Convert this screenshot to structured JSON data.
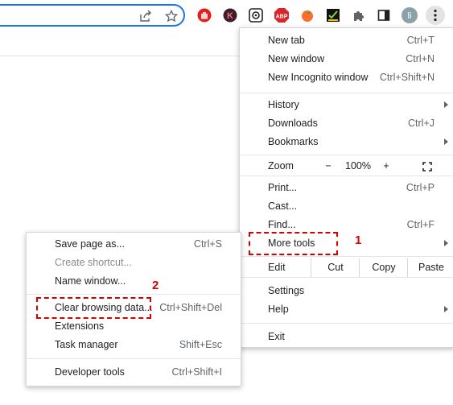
{
  "toolbar": {
    "icons": [
      "share-icon",
      "bookmark-star-icon",
      "red-hand-extension-icon",
      "k-extension-icon",
      "spiral-extension-icon",
      "adblock-plus-icon",
      "tomato-extension-icon",
      "checkmark-extension-icon",
      "puzzle-extensions-icon",
      "side-panel-icon",
      "profile-avatar",
      "kebab-menu-icon"
    ],
    "abp_label": "ABP",
    "k_label": "K",
    "avatar_label": "li"
  },
  "main_menu": {
    "new_tab": {
      "label": "New tab",
      "shortcut": "Ctrl+T"
    },
    "new_window": {
      "label": "New window",
      "shortcut": "Ctrl+N"
    },
    "new_incognito": {
      "label": "New Incognito window",
      "shortcut": "Ctrl+Shift+N"
    },
    "history": {
      "label": "History"
    },
    "downloads": {
      "label": "Downloads",
      "shortcut": "Ctrl+J"
    },
    "bookmarks": {
      "label": "Bookmarks"
    },
    "zoom": {
      "label": "Zoom",
      "minus": "−",
      "value": "100%",
      "plus": "+"
    },
    "print": {
      "label": "Print...",
      "shortcut": "Ctrl+P"
    },
    "cast": {
      "label": "Cast..."
    },
    "find": {
      "label": "Find...",
      "shortcut": "Ctrl+F"
    },
    "more_tools": {
      "label": "More tools"
    },
    "edit": {
      "label": "Edit",
      "cut": "Cut",
      "copy": "Copy",
      "paste": "Paste"
    },
    "settings": {
      "label": "Settings"
    },
    "help": {
      "label": "Help"
    },
    "exit": {
      "label": "Exit"
    }
  },
  "sub_menu": {
    "save_page": {
      "label": "Save page as...",
      "shortcut": "Ctrl+S"
    },
    "create_shortcut": {
      "label": "Create shortcut..."
    },
    "name_window": {
      "label": "Name window..."
    },
    "clear_browsing": {
      "label": "Clear browsing data...",
      "shortcut": "Ctrl+Shift+Del"
    },
    "extensions": {
      "label": "Extensions"
    },
    "task_manager": {
      "label": "Task manager",
      "shortcut": "Shift+Esc"
    },
    "developer_tools": {
      "label": "Developer tools",
      "shortcut": "Ctrl+Shift+I"
    }
  },
  "annotations": {
    "step1": "1",
    "step2": "2",
    "color": "#d50000"
  }
}
